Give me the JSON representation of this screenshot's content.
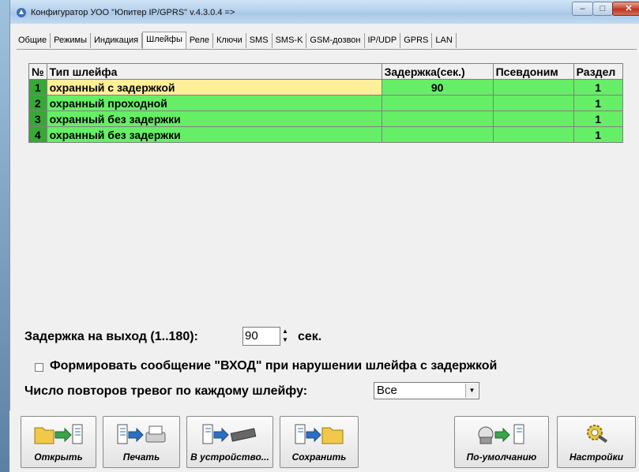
{
  "window": {
    "title": "Конфигуратор УОО \"Юпитер IP/GPRS\" v.4.3.0.4   =>"
  },
  "tabs": [
    {
      "label": "Общие",
      "active": false
    },
    {
      "label": "Режимы",
      "active": false
    },
    {
      "label": "Индикация",
      "active": false
    },
    {
      "label": "Шлейфы",
      "active": true
    },
    {
      "label": "Реле",
      "active": false
    },
    {
      "label": "Ключи",
      "active": false
    },
    {
      "label": "SMS",
      "active": false
    },
    {
      "label": "SMS-K",
      "active": false
    },
    {
      "label": "GSM-дозвон",
      "active": false
    },
    {
      "label": "IP/UDP",
      "active": false
    },
    {
      "label": "GPRS",
      "active": false
    },
    {
      "label": "LAN",
      "active": false
    }
  ],
  "table": {
    "headers": [
      "№",
      "Тип шлейфа",
      "Задержка(сек.)",
      "Псевдоним",
      "Раздел"
    ],
    "rows": [
      {
        "num": "1",
        "type": "охранный с задержкой",
        "delay": "90",
        "alias": "",
        "part": "1",
        "selected": true
      },
      {
        "num": "2",
        "type": "охранный проходной",
        "delay": "",
        "alias": "",
        "part": "1",
        "selected": false
      },
      {
        "num": "3",
        "type": "охранный без задержки",
        "delay": "",
        "alias": "",
        "part": "1",
        "selected": false
      },
      {
        "num": "4",
        "type": "охранный без задержки",
        "delay": "",
        "alias": "",
        "part": "1",
        "selected": false
      }
    ]
  },
  "exit_delay": {
    "label": "Задержка на выход (1..180):",
    "value": "90",
    "unit": "сек."
  },
  "entry_message": {
    "label": "Формировать сообщение \"ВХОД\" при нарушении шлейфа с задержкой",
    "checked": false
  },
  "alarm_repeats": {
    "label": "Число повторов тревог по каждому шлейфу:",
    "value": "Все"
  },
  "toolbar": {
    "open": "Открыть",
    "print": "Печать",
    "to_device": "В устройство...",
    "save": "Сохранить",
    "defaults": "По-умолчанию",
    "settings": "Настройки"
  }
}
